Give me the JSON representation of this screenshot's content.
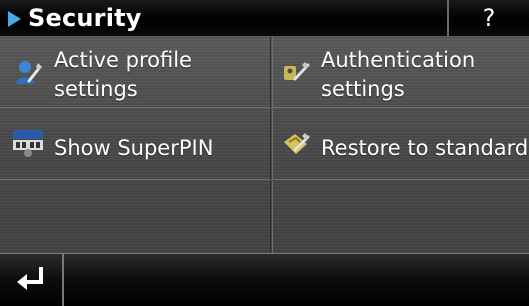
{
  "header": {
    "title": "Security",
    "help_label": "?"
  },
  "menu": {
    "items": [
      {
        "line1": "Active profile",
        "line2": "settings",
        "icon": "profile-settings-icon"
      },
      {
        "line1": "Authentication",
        "line2": "settings",
        "icon": "authentication-key-icon"
      },
      {
        "line1": "Show SuperPIN",
        "icon": "superpin-icon"
      },
      {
        "line1": "Restore to standard",
        "icon": "restore-icon"
      }
    ]
  },
  "colors": {
    "accent": "#49a8ec",
    "background": "#4d4d4d",
    "bar": "#000000"
  },
  "footer": {
    "back_icon": "return-arrow-icon"
  }
}
